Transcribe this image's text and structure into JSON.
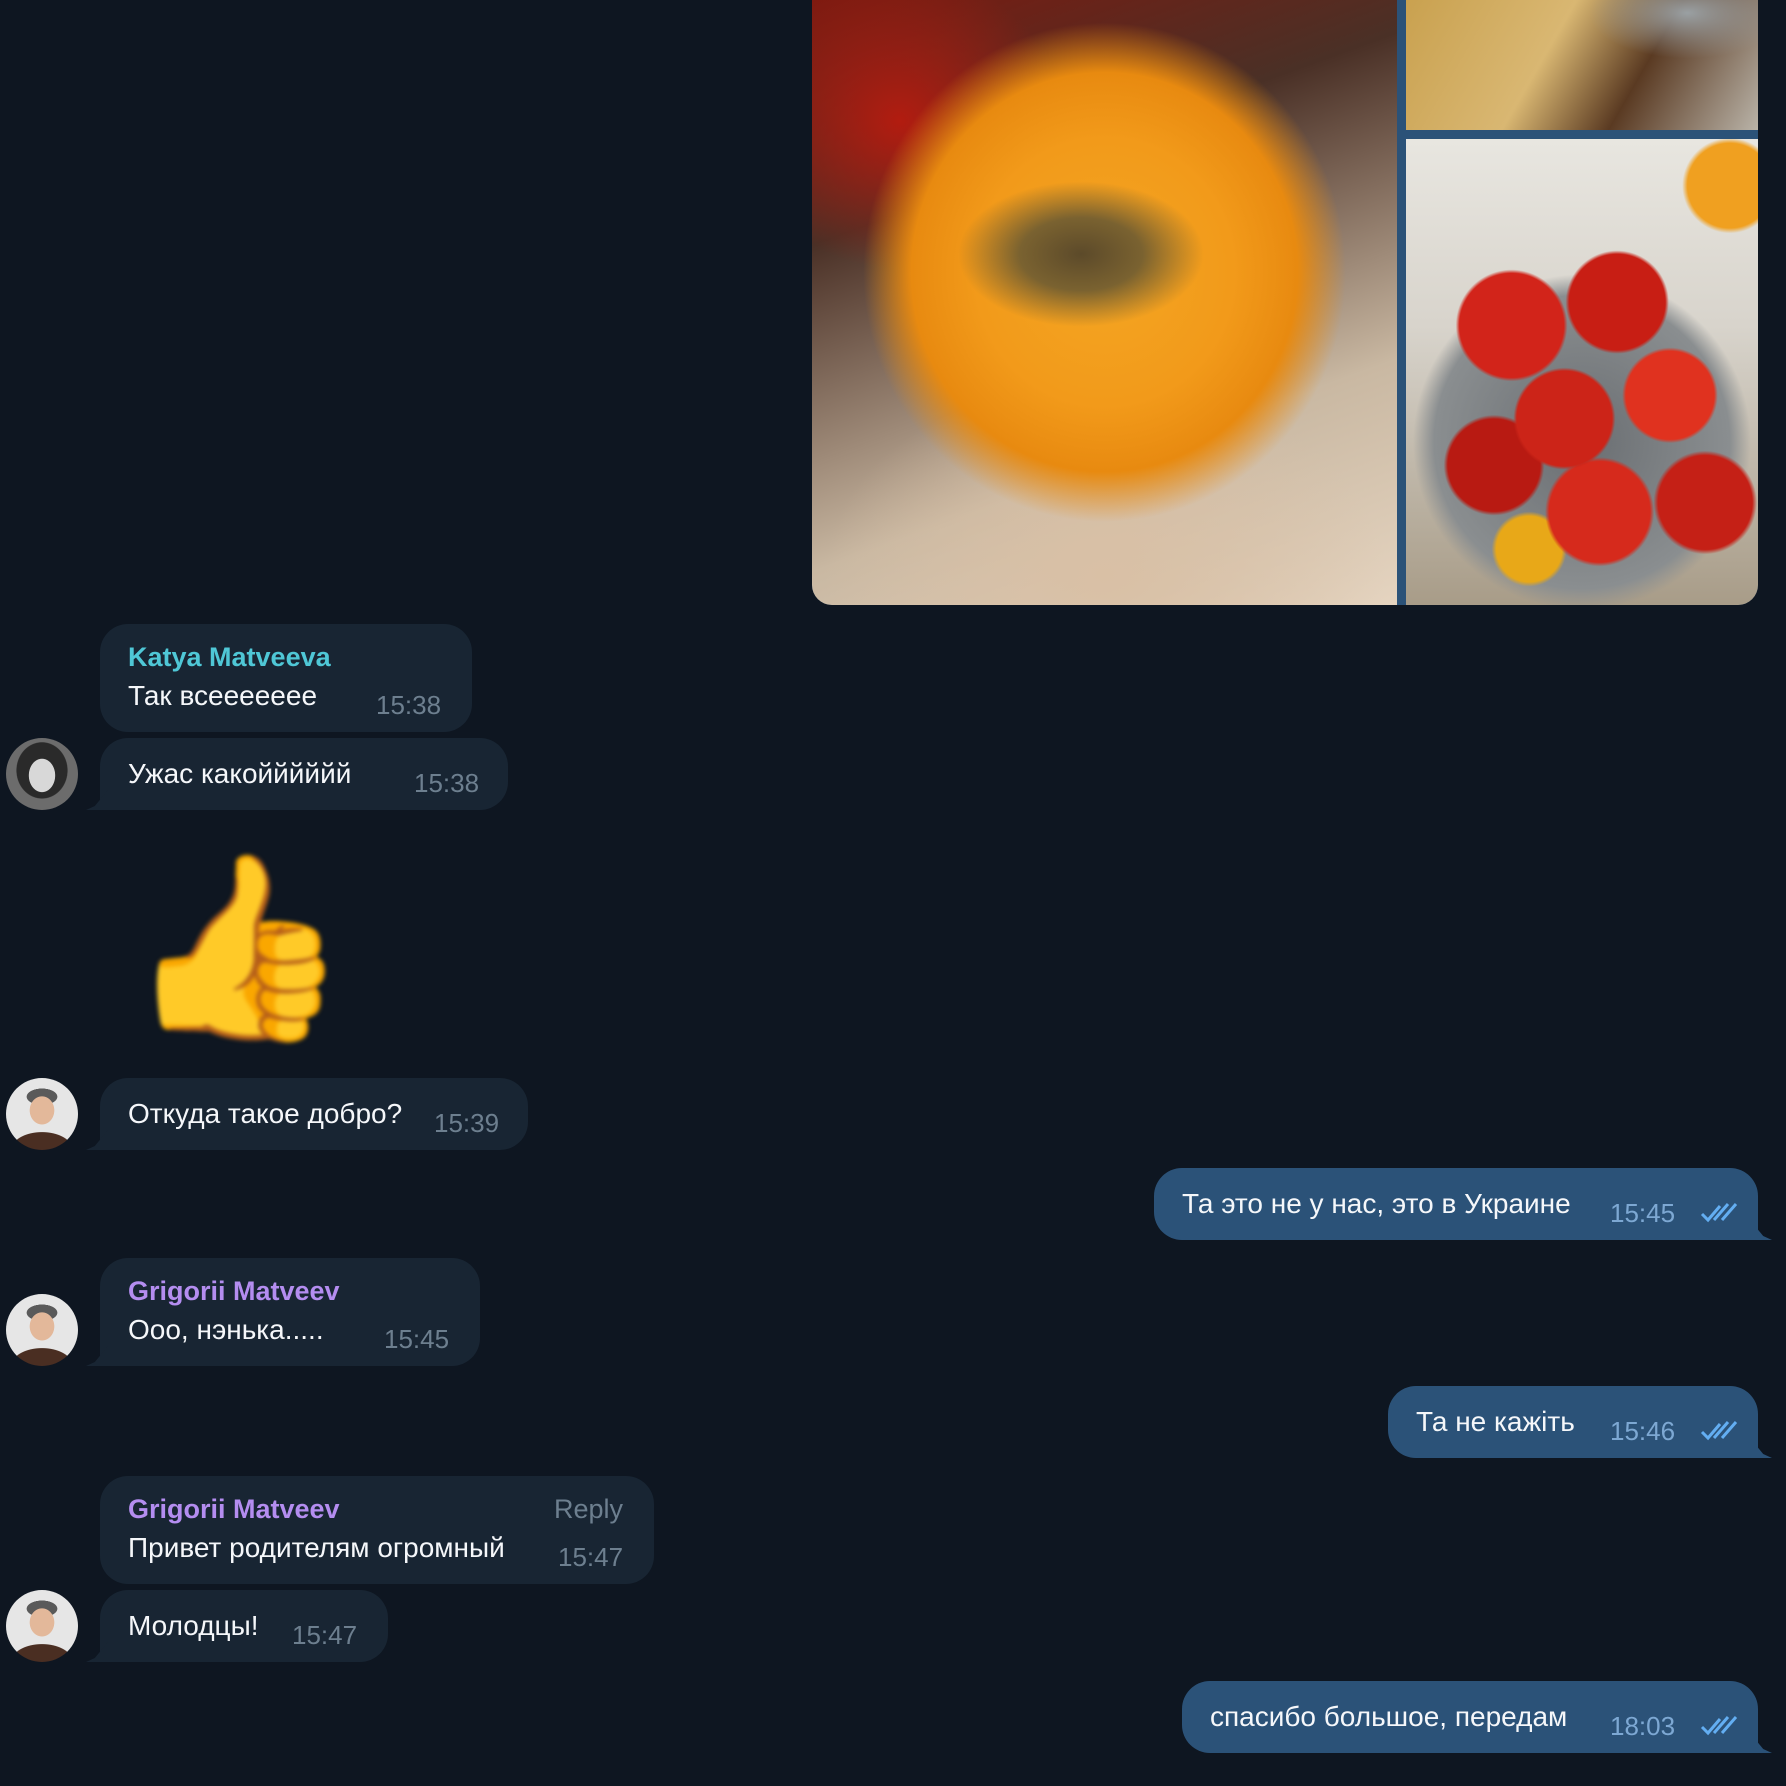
{
  "colors": {
    "background": "#0e1621",
    "incoming_bubble": "#182533",
    "outgoing_bubble": "#2b5278",
    "katya_name": "#4fc7d6",
    "grigorii_name": "#b48df0",
    "timestamp": "#6d7f8f",
    "read_check": "#63aef2"
  },
  "album": {
    "photos": [
      "yellow-tomato-photo",
      "kitchen-photo",
      "red-tomatoes-bowl-photo"
    ]
  },
  "messages": {
    "m1": {
      "sender": "Katya Matveeva",
      "text": "Так всеееееее",
      "time": "15:38"
    },
    "m2": {
      "text": "Ужас какойййййй",
      "time": "15:38"
    },
    "m3": {
      "sticker": "👍"
    },
    "m4": {
      "text": "Откуда такое добро?",
      "time": "15:39"
    },
    "m5": {
      "text": "Та это не у нас, это в Украине",
      "time": "15:45"
    },
    "m6": {
      "sender": "Grigorii Matveev",
      "text": "Ооо, нэнька.....",
      "time": "15:45"
    },
    "m7": {
      "text": "Та не кажіть",
      "time": "15:46"
    },
    "m8": {
      "sender": "Grigorii Matveev",
      "reply": "Reply",
      "text": "Привет родителям огромный",
      "time": "15:47"
    },
    "m9": {
      "text": "Молодцы!",
      "time": "15:47"
    },
    "m10": {
      "text": "спасибо большое, передам",
      "time": "18:03"
    }
  }
}
